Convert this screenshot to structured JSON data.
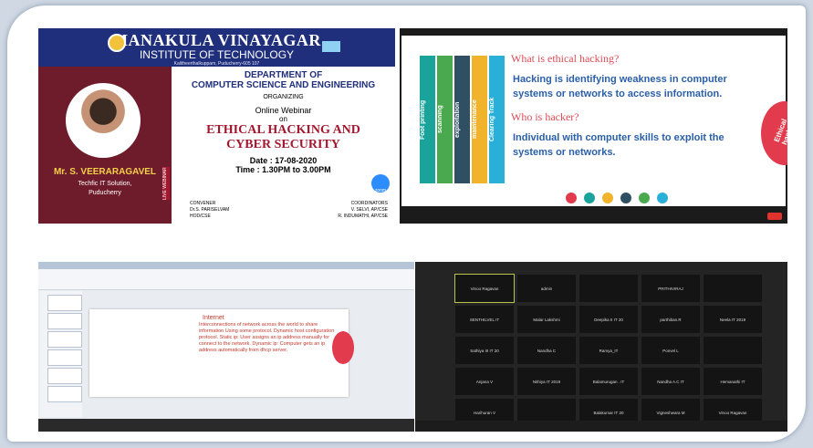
{
  "poster": {
    "college": "MANAKULA VINAYAGAR",
    "institute": "INSTITUTE OF TECHNOLOGY",
    "address": "Kalitheerthalkuppam, Puducherry-605 107",
    "department_line1": "DEPARTMENT OF",
    "department_line2": "COMPUTER SCIENCE AND ENGINEERING",
    "organizing": "ORGANIZING",
    "event_type": "Online Webinar",
    "on": "on",
    "title_line1": "ETHICAL HACKING AND",
    "title_line2": "CYBER SECURITY",
    "date": "Date : 17-08-2020",
    "time": "Time : 1.30PM to 3.00PM",
    "speaker": "Mr. S. VEERARAGAVEL",
    "speaker_org_line1": "Techfic IT Solution,",
    "speaker_org_line2": "Puducherry",
    "live_label": "LIVE WEBINAR",
    "zoom_label": "zoom",
    "convener_label": "CONVENER",
    "convener_name": "Dr.S. PARISELVAM",
    "convener_role": "HOD/CSE",
    "coordinators_label": "COORDINATORS",
    "coordinator1": "V. SELVI, AP/CSE",
    "coordinator2": "R. INDUMATHI, AP/CSE"
  },
  "slide": {
    "question1": "What is ethical hacking?",
    "answer1": "Hacking is identifying weakness in computer systems or networks to access information.",
    "question2": "Who is hacker?",
    "answer2": "Individual with computer skills to exploit the systems or networks.",
    "badge": "Ethical hacking",
    "strips": [
      "Foot printing",
      "scanning",
      "exploitation",
      "maintenance",
      "Clearing Track"
    ],
    "strip_colors": [
      "#1aa39a",
      "#4aa84f",
      "#2f4f63",
      "#f0b32b",
      "#2ab0d8"
    ],
    "dot_colors": [
      "#e13b4d",
      "#1aa39a",
      "#f0b32b",
      "#2f4f63",
      "#4aa84f",
      "#2ab0d8"
    ]
  },
  "ppt": {
    "heading": "Internet",
    "text": "Interconnections of network across the world to share information Using some protocol. Dynamic host configuration protocol. Static ip: User assigns an ip address manually for connect to the network. Dynamic ip: Computer gets an ip address automatically from dhcp server."
  },
  "gallery": {
    "participants": [
      "Vinoo Ragavan",
      "admin",
      "",
      "PRITHIVIRAJ",
      "",
      "SENTHILVEL IT",
      "Malar Lakshmi",
      "Deepika II IT 20",
      "parthiban.R",
      "Neela IT 2019",
      "Sathiya III IT 20",
      "Nandha C",
      "Ramya_IT",
      "Ponvel L",
      "",
      "Anjana V",
      "Nithiya IT 2019",
      "Balamurugan . IT",
      "Nandha A.C IT",
      "Hemanathi IT",
      "Harihuran V",
      "",
      "Balakumar IT 20",
      "Vigneshwara M",
      "Vinoo Ragavan"
    ]
  }
}
